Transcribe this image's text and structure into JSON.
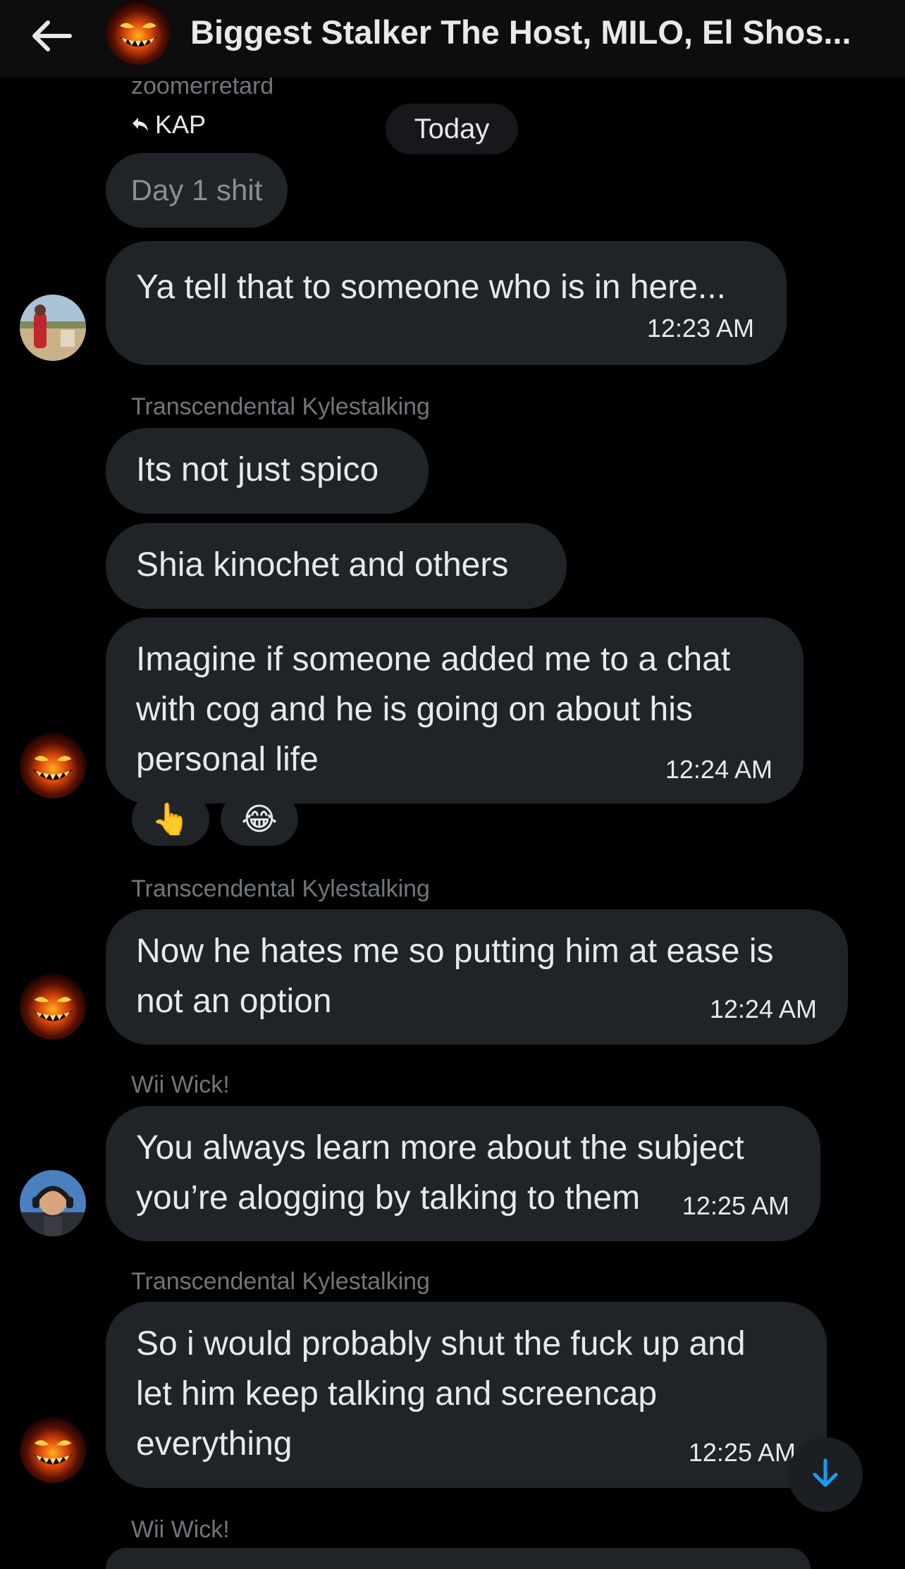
{
  "header": {
    "title": "Biggest Stalker The Host, MILO, El Shos...",
    "back_icon": "arrow-left-icon",
    "avatar_icon": "evil-grin-avatar"
  },
  "date_divider": "Today",
  "top_context": {
    "sender": "zoomerretard",
    "reply_to": "KAP",
    "reply_icon": "reply-arrow-icon",
    "quoted_text": "Day 1 shit"
  },
  "messages": [
    {
      "sender": "",
      "lines": [
        "Ya tell that to someone who is in here..."
      ],
      "time": "12:23 AM",
      "avatar": "landscape-photo-avatar"
    },
    {
      "sender": "Transcendental Kylestalking",
      "lines": [
        "Its not just spico"
      ],
      "time": ""
    },
    {
      "sender": "",
      "lines": [
        "Shia kinochet and others"
      ],
      "time": ""
    },
    {
      "sender": "",
      "lines": [
        "Imagine if someone added me to a chat",
        "with cog and he is going on about his",
        "personal life"
      ],
      "time": "12:24 AM",
      "avatar": "evil-grin-avatar",
      "reactions": [
        "👆",
        "😂"
      ]
    },
    {
      "sender": "Transcendental Kylestalking",
      "lines": [
        "Now he hates me so putting him at ease is",
        "not an option"
      ],
      "time": "12:24 AM",
      "avatar": "evil-grin-avatar"
    },
    {
      "sender": "Wii Wick!",
      "lines": [
        "You always learn more about the subject",
        "you’re alogging by talking to them"
      ],
      "time": "12:25 AM",
      "avatar": "headphones-man-avatar"
    },
    {
      "sender": "Transcendental Kylestalking",
      "lines": [
        "So i would probably shut the fuck up and",
        "let him keep talking and screencap",
        "everything"
      ],
      "time": "12:25 AM",
      "avatar": "evil-grin-avatar"
    }
  ],
  "bottom_sender": "Wii Wick!",
  "scroll_down_icon": "arrow-down-icon",
  "colors": {
    "background": "#000000",
    "bubble": "#202327",
    "text": "#e7e9ea",
    "muted": "#71767b",
    "accent": "#1d9bf0"
  }
}
